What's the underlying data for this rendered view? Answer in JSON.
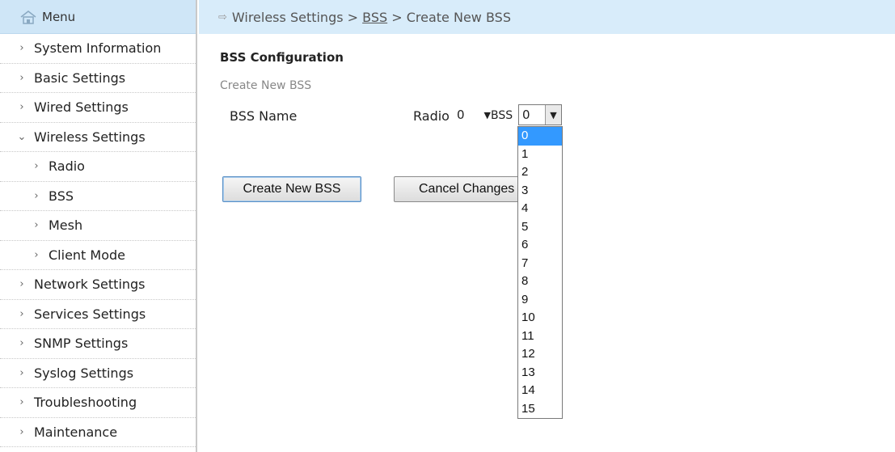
{
  "sidebar": {
    "header": "Menu",
    "items": [
      {
        "label": "System Information",
        "chev": "›"
      },
      {
        "label": "Basic Settings",
        "chev": "›"
      },
      {
        "label": "Wired Settings",
        "chev": "›"
      },
      {
        "label": "Wireless Settings",
        "chev": "⌄"
      },
      {
        "label": "Radio",
        "chev": "›"
      },
      {
        "label": "BSS",
        "chev": "›"
      },
      {
        "label": "Mesh",
        "chev": "›"
      },
      {
        "label": "Client Mode",
        "chev": "›"
      },
      {
        "label": "Network Settings",
        "chev": "›"
      },
      {
        "label": "Services Settings",
        "chev": "›"
      },
      {
        "label": "SNMP Settings",
        "chev": "›"
      },
      {
        "label": "Syslog Settings",
        "chev": "›"
      },
      {
        "label": "Troubleshooting",
        "chev": "›"
      },
      {
        "label": "Maintenance",
        "chev": "›"
      }
    ]
  },
  "breadcrumb": {
    "part1": "Wireless Settings > ",
    "link": "BSS",
    "part2": " > Create New BSS"
  },
  "content": {
    "section_title": "BSS Configuration",
    "sub_title": "Create New BSS",
    "bss_name_label": "BSS Name",
    "radio_label": "Radio",
    "radio_value": "0",
    "bss_label": "BSS",
    "bss_value": "0",
    "bss_options": [
      "0",
      "1",
      "2",
      "3",
      "4",
      "5",
      "6",
      "7",
      "8",
      "9",
      "10",
      "11",
      "12",
      "13",
      "14",
      "15"
    ],
    "create_button": "Create New BSS",
    "cancel_button": "Cancel Changes"
  },
  "colors": {
    "header_bg": "#d8ecfa",
    "selected_option": "#3399ff"
  }
}
